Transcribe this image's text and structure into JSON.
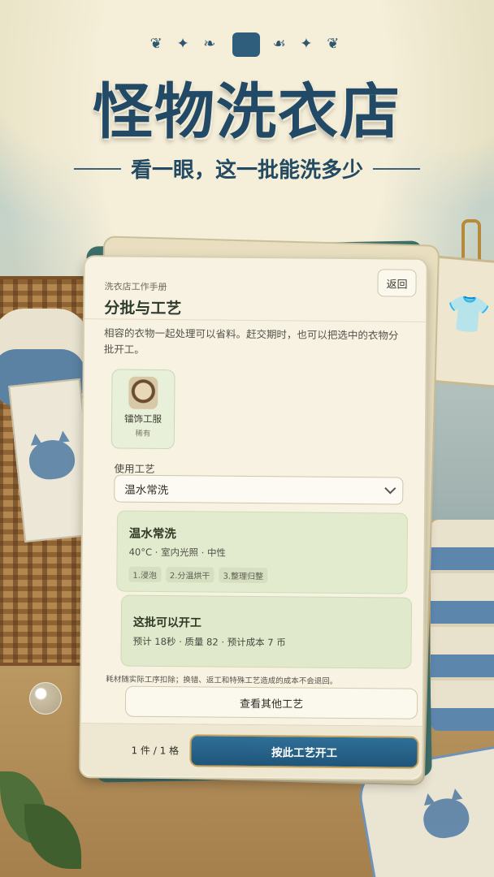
{
  "app": {
    "title": "怪物洗衣店",
    "subtitle": "看一眼，这一批能洗多少"
  },
  "header": {
    "manual_label": "洗衣店工作手册",
    "back_label": "返回",
    "page_title": "分批与工艺"
  },
  "description": "相容的衣物一起处理可以省料。赶交期时，也可以把选中的衣物分批开工。",
  "item": {
    "name": "镭饰工服",
    "rarity": "稀有",
    "icon": "shirt-icon"
  },
  "craft_select": {
    "label": "使用工艺",
    "value": "温水常洗"
  },
  "craft_detail": {
    "name": "温水常洗",
    "meta": "40°C · 室内光照 · 中性",
    "steps": [
      "1.浸泡",
      "2.分温烘干",
      "3.整理归整"
    ]
  },
  "ready": {
    "title": "这批可以开工",
    "meta": "预计 18秒 · 质量 82 · 预计成本 7 币"
  },
  "note": "耗材随实际工序扣除；换错、返工和特殊工艺造成的成本不会退回。",
  "buttons": {
    "other_crafts": "查看其他工艺",
    "start": "按此工艺开工"
  },
  "footer": {
    "count": "1 件 / 1 格"
  },
  "colors": {
    "primary_button": "#1f5579",
    "craft_box": "#e3ebcf",
    "title": "#224a66"
  }
}
